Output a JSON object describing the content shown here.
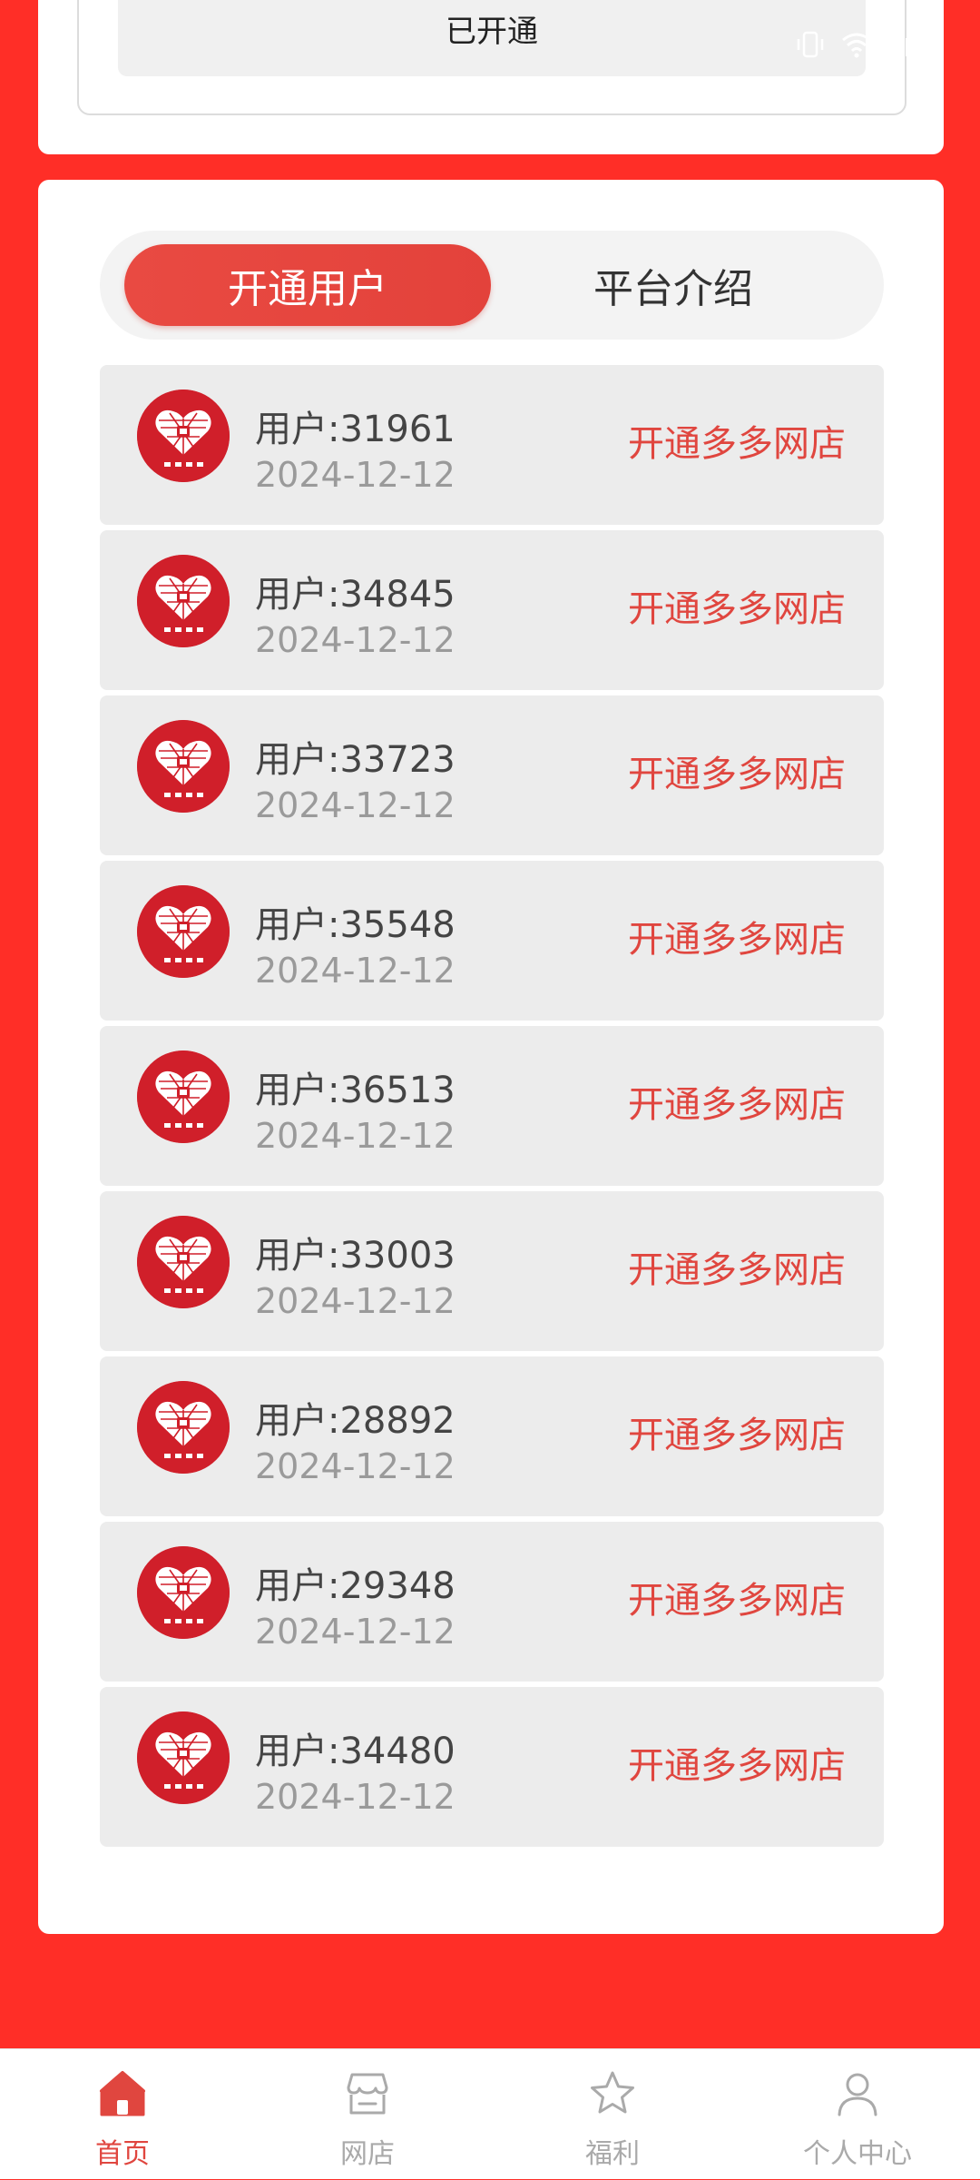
{
  "top_card": {
    "status_label": "已开通"
  },
  "tabs": [
    {
      "label": "开通用户",
      "active": true
    },
    {
      "label": "平台介绍",
      "active": false
    }
  ],
  "users": [
    {
      "name": "用户:31961",
      "date": "2024-12-12",
      "action": "开通多多网店"
    },
    {
      "name": "用户:34845",
      "date": "2024-12-12",
      "action": "开通多多网店"
    },
    {
      "name": "用户:33723",
      "date": "2024-12-12",
      "action": "开通多多网店"
    },
    {
      "name": "用户:35548",
      "date": "2024-12-12",
      "action": "开通多多网店"
    },
    {
      "name": "用户:36513",
      "date": "2024-12-12",
      "action": "开通多多网店"
    },
    {
      "name": "用户:33003",
      "date": "2024-12-12",
      "action": "开通多多网店"
    },
    {
      "name": "用户:28892",
      "date": "2024-12-12",
      "action": "开通多多网店"
    },
    {
      "name": "用户:29348",
      "date": "2024-12-12",
      "action": "开通多多网店"
    },
    {
      "name": "用户:34480",
      "date": "2024-12-12",
      "action": "开通多多网店"
    }
  ],
  "bottom_nav": [
    {
      "label": "首页",
      "icon": "home-icon",
      "active": true
    },
    {
      "label": "网店",
      "icon": "store-icon",
      "active": false
    },
    {
      "label": "福利",
      "icon": "star-icon",
      "active": false
    },
    {
      "label": "个人中心",
      "icon": "user-icon",
      "active": false
    }
  ],
  "colors": {
    "background": "#ff2e27",
    "accent": "#e0463f",
    "avatar": "#d01f2a"
  }
}
